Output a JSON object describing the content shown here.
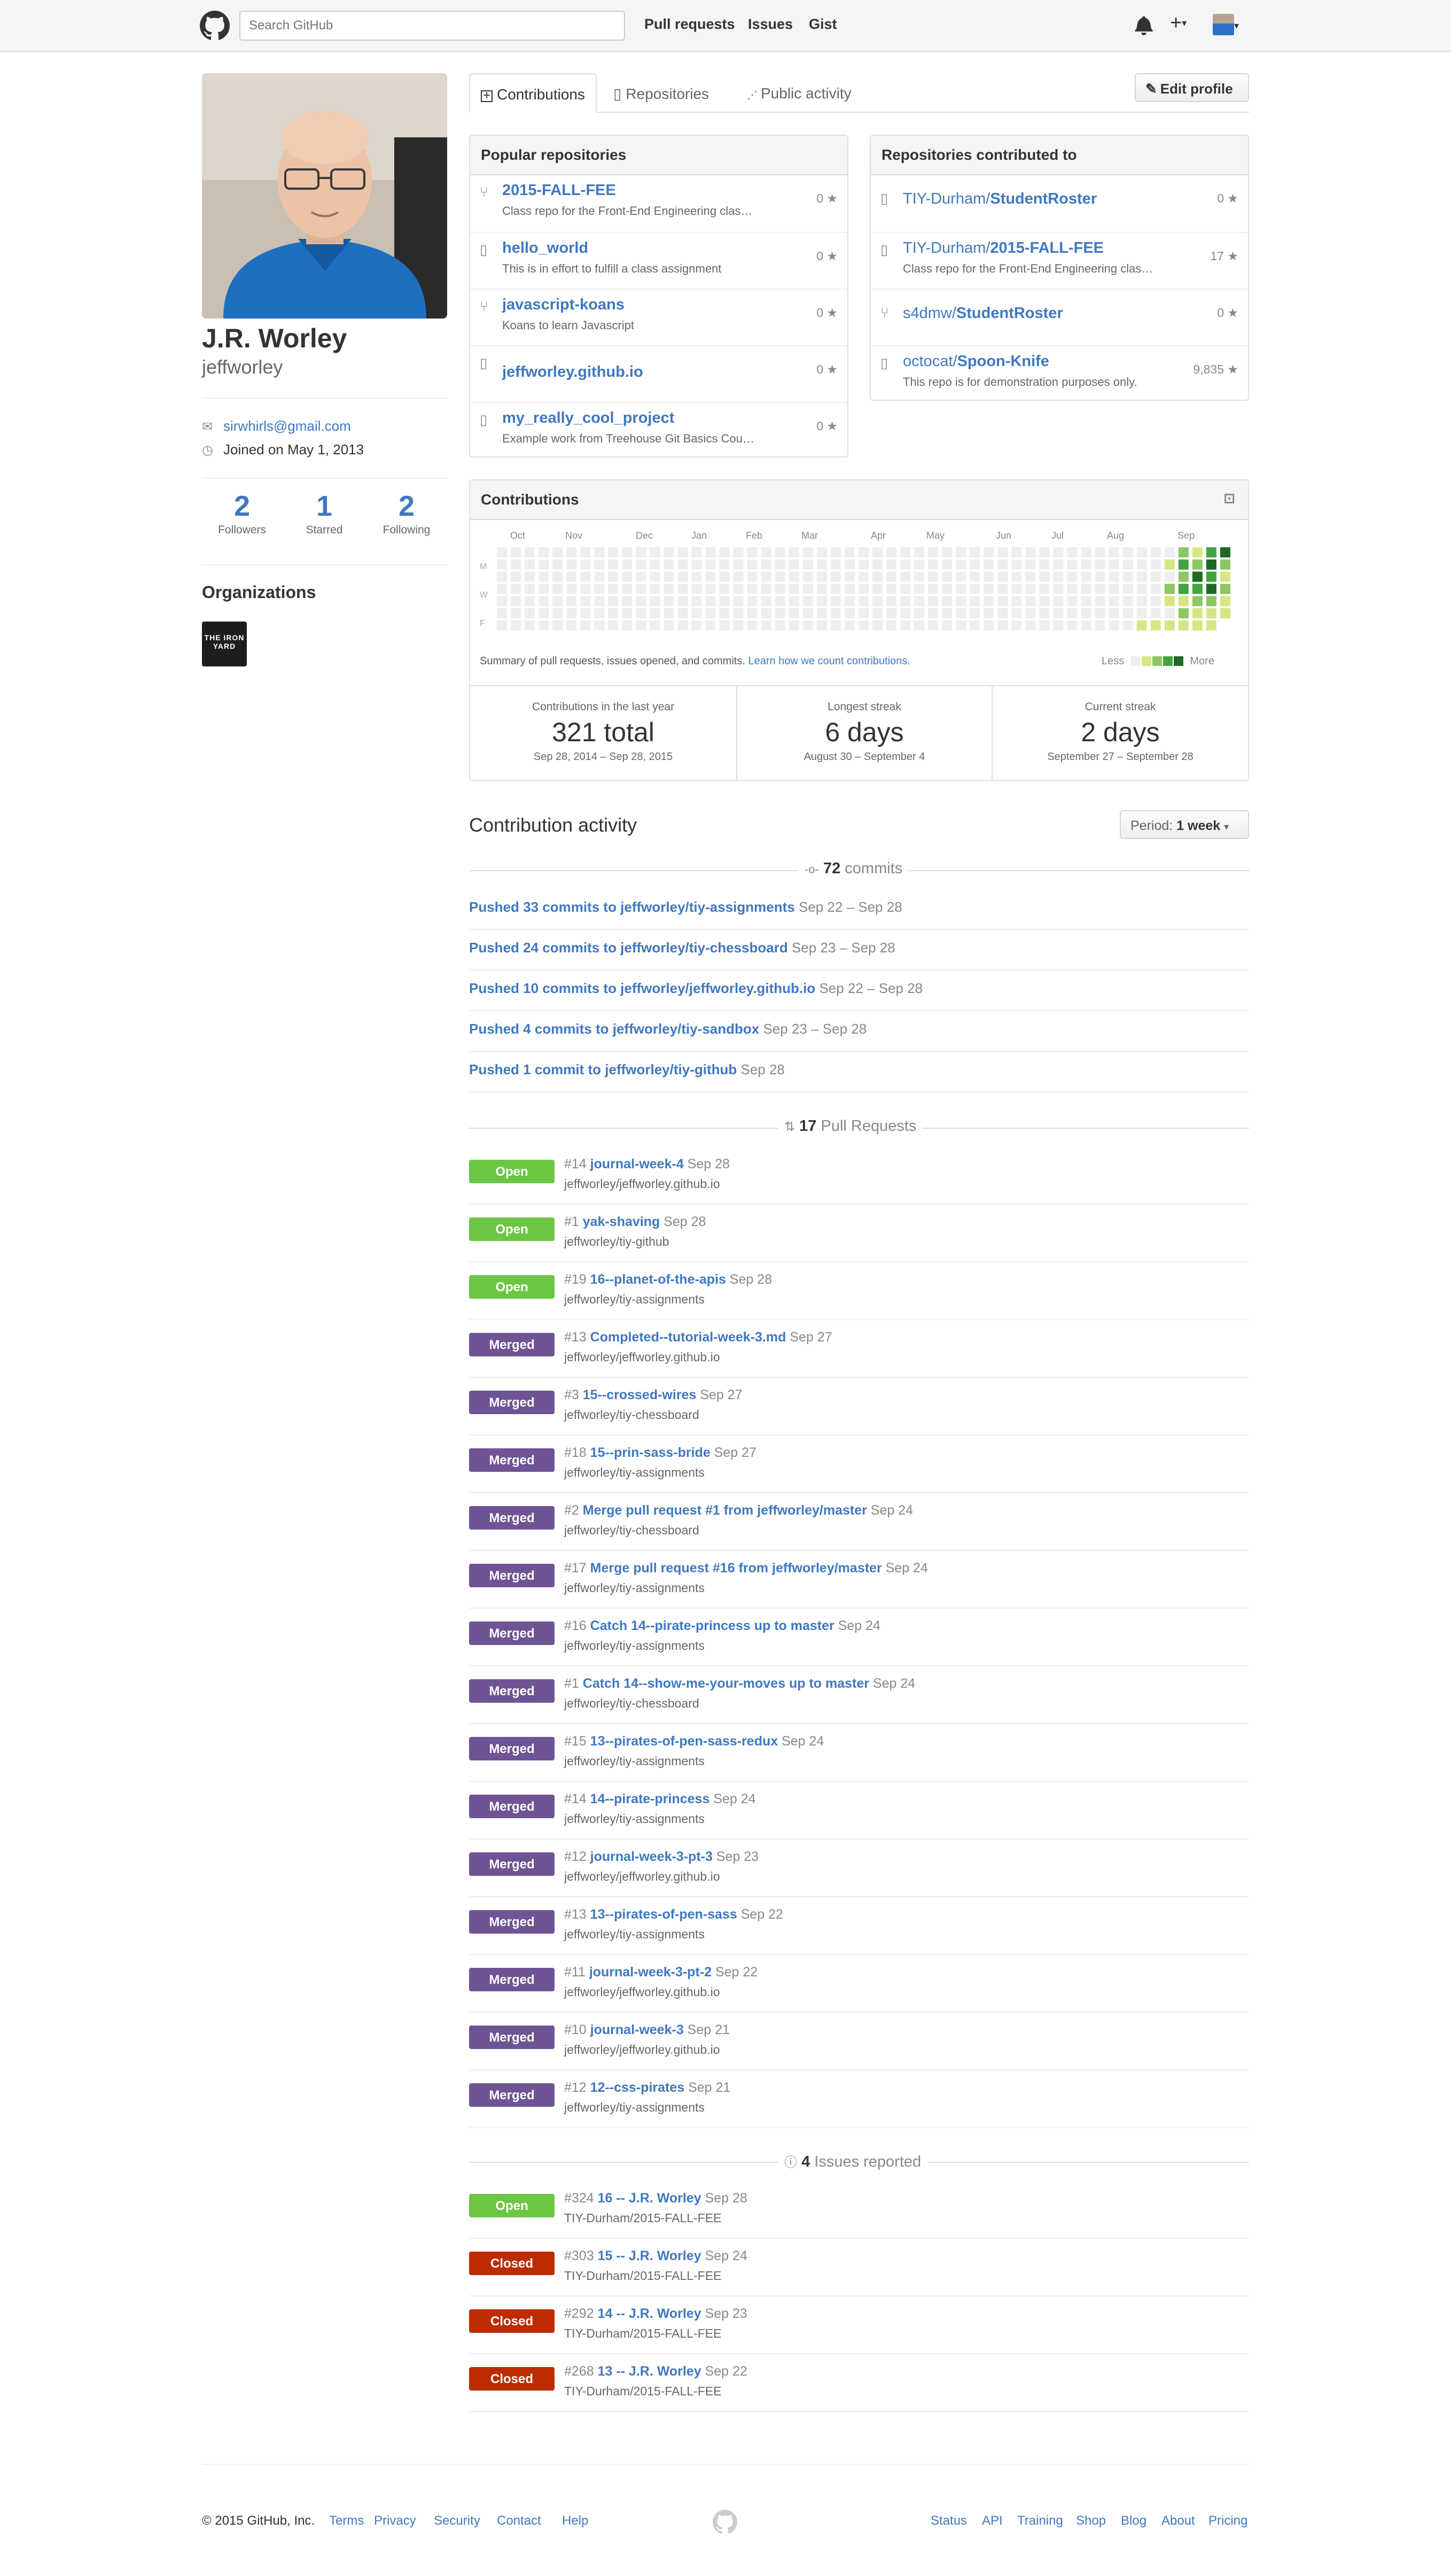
{
  "header": {
    "search_placeholder": "Search GitHub",
    "nav": [
      "Pull requests",
      "Issues",
      "Gist"
    ],
    "icons": [
      "bell-icon",
      "plus-icon",
      "avatar-menu"
    ]
  },
  "profile": {
    "name": "J.R. Worley",
    "login": "jeffworley",
    "email": "sirwhirls@gmail.com",
    "joined": "Joined on May 1, 2013",
    "stats": [
      {
        "num": "2",
        "label": "Followers"
      },
      {
        "num": "1",
        "label": "Starred"
      },
      {
        "num": "2",
        "label": "Following"
      }
    ],
    "organizations_title": "Organizations",
    "org_logo_text": "THE IRON YARD"
  },
  "tabs": [
    "Contributions",
    "Repositories",
    "Public activity"
  ],
  "edit_profile": "Edit profile",
  "popular": {
    "title": "Popular repositories",
    "items": [
      {
        "icon": "fork-icon",
        "name": "2015-FALL-FEE",
        "desc": "Class repo for the Front-End Engineering clas…",
        "stars": "0"
      },
      {
        "icon": "repo-icon",
        "name": "hello_world",
        "desc": "This is in effort to fulfill a class assignment",
        "stars": "0"
      },
      {
        "icon": "fork-icon",
        "name": "javascript-koans",
        "desc": "Koans to learn Javascript",
        "stars": "0"
      },
      {
        "icon": "repo-icon",
        "name": "jeffworley.github.io",
        "desc": "",
        "stars": "0"
      },
      {
        "icon": "repo-icon",
        "name": "my_really_cool_project",
        "desc": "Example work from Treehouse Git Basics Cou…",
        "stars": "0"
      }
    ]
  },
  "contributed": {
    "title": "Repositories contributed to",
    "items": [
      {
        "icon": "repo-icon",
        "owner": "TIY-Durham/",
        "name": "StudentRoster",
        "desc": "",
        "stars": "0"
      },
      {
        "icon": "repo-icon",
        "owner": "TIY-Durham/",
        "name": "2015-FALL-FEE",
        "desc": "Class repo for the Front-End Engineering clas…",
        "stars": "17"
      },
      {
        "icon": "fork-icon",
        "owner": "s4dmw/",
        "name": "StudentRoster",
        "desc": "",
        "stars": "0"
      },
      {
        "icon": "repo-icon",
        "owner": "octocat/",
        "name": "Spoon-Knife",
        "desc": "This repo is for demonstration purposes only.",
        "stars": "9,835"
      }
    ]
  },
  "contributions": {
    "title": "Contributions",
    "months": [
      "Oct",
      "Nov",
      "Dec",
      "Jan",
      "Feb",
      "Mar",
      "Apr",
      "May",
      "Jun",
      "Jul",
      "Aug",
      "Sep"
    ],
    "days": [
      "M",
      "W",
      "F"
    ],
    "summary": "Summary of pull requests, issues opened, and commits.",
    "learn_link": "Learn how we count contributions.",
    "less": "Less",
    "more": "More",
    "colors": [
      "#eeeeee",
      "#d6e685",
      "#8cc665",
      "#44a340",
      "#1e6823"
    ],
    "stats": [
      {
        "label": "Contributions in the last year",
        "value": "321 total",
        "range": "Sep 28, 2014 – Sep 28, 2015"
      },
      {
        "label": "Longest streak",
        "value": "6 days",
        "range": "August 30 – September 4"
      },
      {
        "label": "Current streak",
        "value": "2 days",
        "range": "September 27 – September 28"
      }
    ]
  },
  "activity": {
    "title": "Contribution activity",
    "period_label": "Period:",
    "period_value": "1 week",
    "commits_count": "72",
    "commits_label": "commits",
    "commits": [
      {
        "text": "Pushed 33 commits to jeffworley/tiy-assignments",
        "date": "Sep 22 – Sep 28"
      },
      {
        "text": "Pushed 24 commits to jeffworley/tiy-chessboard",
        "date": "Sep 23 – Sep 28"
      },
      {
        "text": "Pushed 10 commits to jeffworley/jeffworley.github.io",
        "date": "Sep 22 – Sep 28"
      },
      {
        "text": "Pushed 4 commits to jeffworley/tiy-sandbox",
        "date": "Sep 23 – Sep 28"
      },
      {
        "text": "Pushed 1 commit to jeffworley/tiy-github",
        "date": "Sep 28"
      }
    ],
    "pr_count": "17",
    "pr_label": "Pull Requests",
    "pull_requests": [
      {
        "state": "Open",
        "num": "#14",
        "title": "journal-week-4",
        "date": "Sep 28",
        "repo": "jeffworley/jeffworley.github.io"
      },
      {
        "state": "Open",
        "num": "#1",
        "title": "yak-shaving",
        "date": "Sep 28",
        "repo": "jeffworley/tiy-github"
      },
      {
        "state": "Open",
        "num": "#19",
        "title": "16--planet-of-the-apis",
        "date": "Sep 28",
        "repo": "jeffworley/tiy-assignments"
      },
      {
        "state": "Merged",
        "num": "#13",
        "title": "Completed--tutorial-week-3.md",
        "date": "Sep 27",
        "repo": "jeffworley/jeffworley.github.io"
      },
      {
        "state": "Merged",
        "num": "#3",
        "title": "15--crossed-wires",
        "date": "Sep 27",
        "repo": "jeffworley/tiy-chessboard"
      },
      {
        "state": "Merged",
        "num": "#18",
        "title": "15--prin-sass-bride",
        "date": "Sep 27",
        "repo": "jeffworley/tiy-assignments"
      },
      {
        "state": "Merged",
        "num": "#2",
        "title": "Merge pull request #1 from jeffworley/master",
        "date": "Sep 24",
        "repo": "jeffworley/tiy-chessboard"
      },
      {
        "state": "Merged",
        "num": "#17",
        "title": "Merge pull request #16 from jeffworley/master",
        "date": "Sep 24",
        "repo": "jeffworley/tiy-assignments"
      },
      {
        "state": "Merged",
        "num": "#16",
        "title": "Catch 14--pirate-princess up to master",
        "date": "Sep 24",
        "repo": "jeffworley/tiy-assignments"
      },
      {
        "state": "Merged",
        "num": "#1",
        "title": "Catch 14--show-me-your-moves up to master",
        "date": "Sep 24",
        "repo": "jeffworley/tiy-chessboard"
      },
      {
        "state": "Merged",
        "num": "#15",
        "title": "13--pirates-of-pen-sass-redux",
        "date": "Sep 24",
        "repo": "jeffworley/tiy-assignments"
      },
      {
        "state": "Merged",
        "num": "#14",
        "title": "14--pirate-princess",
        "date": "Sep 24",
        "repo": "jeffworley/tiy-assignments"
      },
      {
        "state": "Merged",
        "num": "#12",
        "title": "journal-week-3-pt-3",
        "date": "Sep 23",
        "repo": "jeffworley/jeffworley.github.io"
      },
      {
        "state": "Merged",
        "num": "#13",
        "title": "13--pirates-of-pen-sass",
        "date": "Sep 22",
        "repo": "jeffworley/tiy-assignments"
      },
      {
        "state": "Merged",
        "num": "#11",
        "title": "journal-week-3-pt-2",
        "date": "Sep 22",
        "repo": "jeffworley/jeffworley.github.io"
      },
      {
        "state": "Merged",
        "num": "#10",
        "title": "journal-week-3",
        "date": "Sep 21",
        "repo": "jeffworley/jeffworley.github.io"
      },
      {
        "state": "Merged",
        "num": "#12",
        "title": "12--css-pirates",
        "date": "Sep 21",
        "repo": "jeffworley/tiy-assignments"
      }
    ],
    "issues_count": "4",
    "issues_label": "Issues reported",
    "issues": [
      {
        "state": "Open",
        "num": "#324",
        "title": "16 -- J.R. Worley",
        "date": "Sep 28",
        "repo": "TIY-Durham/2015-FALL-FEE"
      },
      {
        "state": "Closed",
        "num": "#303",
        "title": "15 -- J.R. Worley",
        "date": "Sep 24",
        "repo": "TIY-Durham/2015-FALL-FEE"
      },
      {
        "state": "Closed",
        "num": "#292",
        "title": "14 -- J.R. Worley",
        "date": "Sep 23",
        "repo": "TIY-Durham/2015-FALL-FEE"
      },
      {
        "state": "Closed",
        "num": "#268",
        "title": "13 -- J.R. Worley",
        "date": "Sep 22",
        "repo": "TIY-Durham/2015-FALL-FEE"
      }
    ]
  },
  "footer": {
    "copyright": "© 2015 GitHub, Inc.",
    "left_links": [
      "Terms",
      "Privacy",
      "Security",
      "Contact",
      "Help"
    ],
    "right_links": [
      "Status",
      "API",
      "Training",
      "Shop",
      "Blog",
      "About",
      "Pricing"
    ]
  }
}
